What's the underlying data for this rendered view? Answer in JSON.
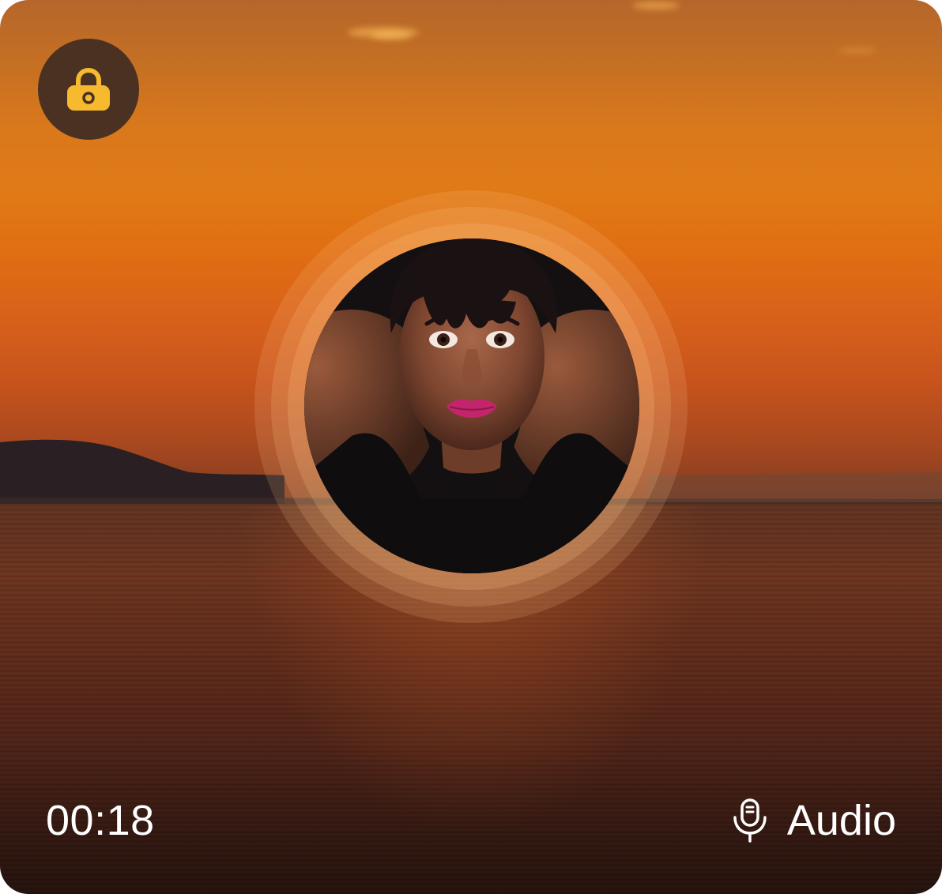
{
  "call": {
    "duration": "00:18",
    "mode_label": "Audio"
  },
  "controls": {
    "lock_icon": "lock-icon",
    "mic_icon": "microphone-icon"
  },
  "colors": {
    "lock_button_bg": "#4a3122",
    "lock_icon": "#f7b92e",
    "text": "#ffffff"
  }
}
